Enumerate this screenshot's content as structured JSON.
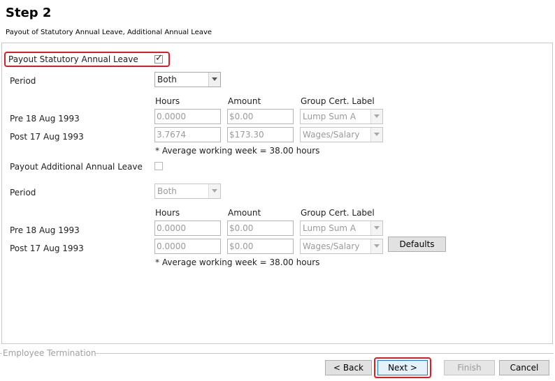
{
  "header": {
    "title": "Step 2",
    "subtitle": "Payout of Statutory Annual Leave, Additional Annual Leave"
  },
  "statutory": {
    "payout_label": "Payout Statutory Annual Leave",
    "payout_checked": true,
    "period_label": "Period",
    "period_value": "Both",
    "col_hours": "Hours",
    "col_amount": "Amount",
    "col_group": "Group Cert. Label",
    "rows": [
      {
        "label": "Pre 18 Aug 1993",
        "hours": "0.0000",
        "amount": "$0.00",
        "group": "Lump Sum A"
      },
      {
        "label": "Post 17 Aug 1993",
        "hours": "3.7674",
        "amount": "$173.30",
        "group": "Wages/Salary"
      }
    ],
    "note": "* Average working week = 38.00 hours"
  },
  "additional": {
    "payout_label": "Payout Additional Annual Leave",
    "payout_checked": false,
    "period_label": "Period",
    "period_value": "Both",
    "col_hours": "Hours",
    "col_amount": "Amount",
    "col_group": "Group Cert. Label",
    "rows": [
      {
        "label": "Pre 18 Aug 1993",
        "hours": "0.0000",
        "amount": "$0.00",
        "group": "Lump Sum A"
      },
      {
        "label": "Post 17 Aug 1993",
        "hours": "0.0000",
        "amount": "$0.00",
        "group": "Wages/Salary"
      }
    ],
    "defaults_label": "Defaults",
    "note": "* Average working week = 38.00 hours"
  },
  "footer": {
    "group_label": "Employee Termination",
    "back_label": "< Back",
    "next_label": "Next >",
    "finish_label": "Finish",
    "cancel_label": "Cancel"
  }
}
